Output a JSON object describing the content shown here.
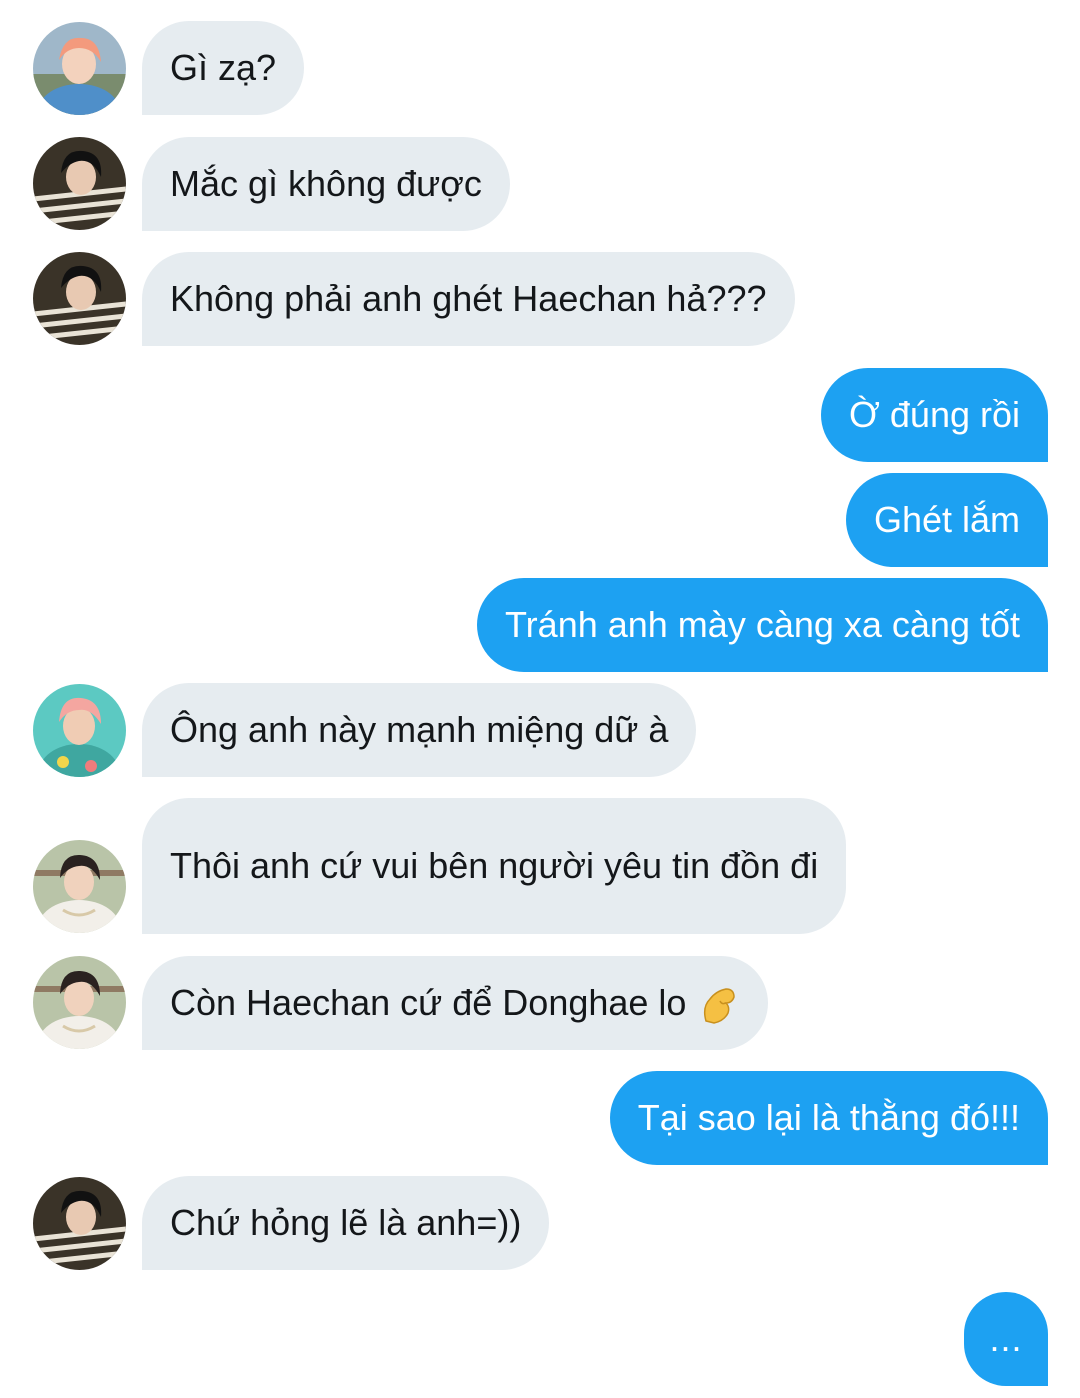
{
  "conversation": {
    "messages": [
      {
        "sender": "incoming",
        "avatar": "avatar-orange-hair",
        "text": "Gì zạ?"
      },
      {
        "sender": "incoming",
        "avatar": "avatar-black-hair-stripes",
        "text": "Mắc gì không được"
      },
      {
        "sender": "incoming",
        "avatar": "avatar-black-hair-stripes",
        "text": "Không phải anh ghét Haechan hả???"
      },
      {
        "sender": "outgoing",
        "text": "Ờ đúng rồi"
      },
      {
        "sender": "outgoing",
        "text": "Ghét lắm"
      },
      {
        "sender": "outgoing",
        "text": "Tránh anh mày càng xa càng tốt"
      },
      {
        "sender": "incoming",
        "avatar": "avatar-pink-hair-floral",
        "text": "Ông anh này mạnh miệng dữ à"
      },
      {
        "sender": "incoming",
        "avatar": "avatar-dark-hair-white-shirt",
        "text": "Thôi anh cứ vui bên người yêu tin đồn đi"
      },
      {
        "sender": "incoming",
        "avatar": "avatar-dark-hair-white-shirt",
        "text": "Còn Haechan cứ để Donghae lo",
        "emoji": "pinching-hand-emoji"
      },
      {
        "sender": "outgoing",
        "text": "Tại sao lại là thằng đó!!!"
      },
      {
        "sender": "incoming",
        "avatar": "avatar-black-hair-stripes",
        "text": "Chứ hỏng lẽ là anh=))"
      }
    ],
    "typing_indicator": "..."
  },
  "colors": {
    "incoming_bubble": "#e6ecf0",
    "incoming_text": "#14171a",
    "outgoing_bubble": "#1da1f2",
    "outgoing_text": "#ffffff",
    "background": "#ffffff"
  }
}
